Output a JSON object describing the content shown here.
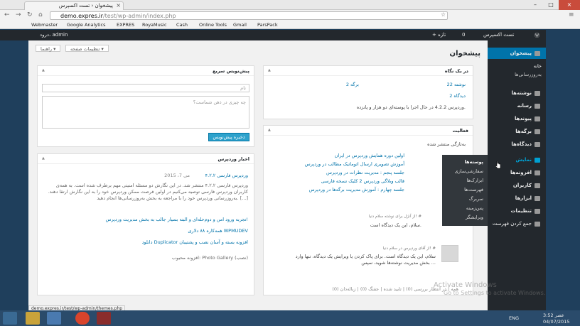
{
  "browser": {
    "tab_title": "پیشخوان ‹ تست اکسپرس",
    "url_host": "demo.expres.ir",
    "url_path": "/test/wp-admin/index.php",
    "bookmarks": [
      "Webmaster",
      "Google Analytics",
      "EXPRES",
      "RoyaMusic",
      "Cash",
      "Online Tools",
      "Gmail",
      "ParsPack"
    ],
    "status_url": "demo.expres.ir/test/wp-admin/themes.php"
  },
  "adminbar": {
    "site_name": "تست اکسپرس",
    "comments_count": "0",
    "new_label": "+ تازه",
    "user_greeting": "درود، admin"
  },
  "sidebar": {
    "dashboard": "پیشخوان",
    "home": "خانه",
    "updates": "به‌روزرسانی‌ها",
    "posts": "نوشته‌ها",
    "media": "رسانه",
    "pages": "برگه‌ها",
    "links": "پیوندها",
    "comments": "دیدگاه‌ها",
    "appearance": "نمایش",
    "plugins": "افزونه‌ها",
    "users": "کاربران",
    "tools": "ابزارها",
    "settings": "تنظیمات",
    "collapse": "جمع کردن فهرست"
  },
  "flyout": [
    "پوسته‌ها",
    "سفارشی‌سازی",
    "ابزارک‌ها",
    "فهرست‌ها",
    "سربرگ",
    "پس‌زمینه",
    "ویرایشگر"
  ],
  "screen_options": "تنظیمات صفحه ▾",
  "help": "راهنما ▾",
  "page_title": "پیشخوان",
  "glance": {
    "title": "در یک نگاه",
    "posts": "22 نوشته",
    "pages": "2 برگه",
    "comments": "2 دیدگاه",
    "version_note": "وردپرس 4.2.2 در حال اجرا با پوسته‌ای دو هزار و پانزده."
  },
  "activity": {
    "title": "فعالیت",
    "recently_published": "به‌تازگی منتشر شده",
    "posts": [
      "اولین دوره همایش وردپرس در ایران",
      "آموزش تصویری ارسال اتوماتیک مطالب در وردپرس",
      "جلسه پنجم : مدیریت نظرات در وردپرس",
      "قالب وبلاگی وردپرس 2 کلیک نسخه فارسی",
      "جلسه چهارم : آموزش مدیریت برگه‌ها در وردپرس"
    ],
    "comment1_meta": "از آنژل برای نوشته سلام دنیا! #",
    "comment1_text": "سلام، این یک دیدگاه است.",
    "comment2_meta": "از آقای وردپرس در سلام دنیا! #",
    "comment2_text": "سلام، این یک دیدگاه است. برای پاک کردن یا ویرایش یک دیدگاه، تنها وارد بخش مدیریت نوشته‌ها شوید، سپس ...",
    "filters": "همه | در انتظار بررسی (0) | تایید شده | جفنگ (0) | زباله‌دان (0)"
  },
  "quickdraft": {
    "title": "پیش‌نویس سریع",
    "title_placeholder": "نام",
    "content_placeholder": "چه چیزی در ذهن شماست؟",
    "save_button": "ذخیره پیش‌نویس"
  },
  "news": {
    "title": "اخبار وردپرس",
    "headline": "وردپرس فارسی ۴.۲.۲",
    "date": "می 7، 2015",
    "body": "وردپرس فارسی ۴.۲.۲ منتشر شد. در این نگارش دو مسئله امنیتی مهم برطرف شده است. به همه‌ی کاربران وردپرس فارسی توصیه می‌کنیم در اولین فرصت ممکن وردپرس خود را به این نگارش ارتقا دهند. به‌روزرسانی وردپرس خود را با مراجعه به بخش به‌روزرسانی‌ها انجام دهید. [...]",
    "link1": "تجربه ورود امن و دوم‌حله‌ای و البته بسیار جالب به بخش مدیریت وردپرس!",
    "link2": "همه‌کاره ۸۸ دلاری WPMUDEV",
    "link3": "دانلود Duplicator افزونه بسته و آسان نصب و پشتیبان",
    "popular": "افزونه محبوب: Photo Gallery (نصب)"
  },
  "windows": {
    "activate_line1": "Activate Windows",
    "activate_line2": "Go to Settings to activate Windows.",
    "lang": "ENG",
    "time": "3:52 عصر",
    "date": "04/07/2015"
  },
  "colors": {
    "accent": "#0073aa",
    "admin_dark": "#23282d",
    "button_blue": "#2ea2cc"
  }
}
